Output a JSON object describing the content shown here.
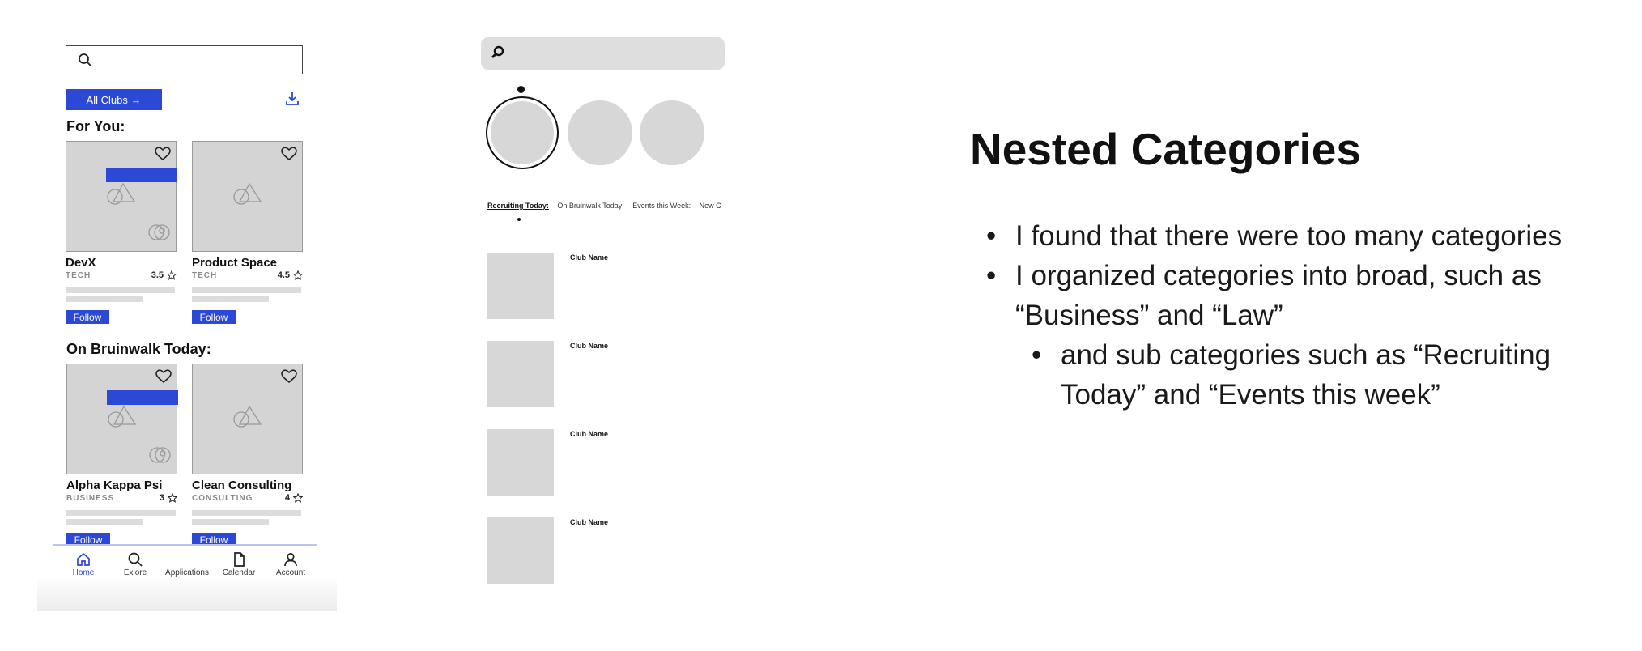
{
  "phone1": {
    "search": {
      "placeholder": ""
    },
    "all_clubs_label": "All Clubs →",
    "sections": [
      {
        "title": "For You:",
        "cards": [
          {
            "name": "DevX",
            "category": "TECH",
            "rating": "3.5",
            "follow_label": "Follow",
            "banner": true
          },
          {
            "name": "Product Space",
            "category": "TECH",
            "rating": "4.5",
            "follow_label": "Follow",
            "banner": false
          }
        ]
      },
      {
        "title": "On Bruinwalk Today:",
        "cards": [
          {
            "name": "Alpha Kappa Psi",
            "category": "BUSINESS",
            "rating": "3",
            "follow_label": "Follow",
            "banner": true
          },
          {
            "name": "Clean Consulting",
            "category": "CONSULTING",
            "rating": "4",
            "follow_label": "Follow",
            "banner": false
          }
        ]
      }
    ],
    "nav": [
      {
        "label": "Home",
        "icon": "home-icon",
        "active": true
      },
      {
        "label": "Exlore",
        "icon": "search-icon",
        "active": false
      },
      {
        "label": "Applications",
        "icon": "",
        "active": false
      },
      {
        "label": "Calendar",
        "icon": "document-icon",
        "active": false
      },
      {
        "label": "Account",
        "icon": "person-icon",
        "active": false
      }
    ],
    "accent_color": "#2b48d6"
  },
  "phone2": {
    "search": {
      "placeholder": ""
    },
    "tabs": [
      {
        "label": "Recruiting Today:",
        "active": true
      },
      {
        "label": "On Bruinwalk Today:",
        "active": false
      },
      {
        "label": "Events this Week:",
        "active": false
      },
      {
        "label": "New C",
        "active": false
      }
    ],
    "list": [
      {
        "name": "Club Name"
      },
      {
        "name": "Club Name"
      },
      {
        "name": "Club Name"
      },
      {
        "name": "Club Name"
      }
    ]
  },
  "slide": {
    "title": "Nested Categories",
    "bullets": [
      {
        "text": "I found that there were too many categories",
        "level": 1
      },
      {
        "text": "I organized categories into broad, such as “Business” and “Law”",
        "level": 1
      },
      {
        "text": "and sub categories such as “Recruiting Today” and “Events this week”",
        "level": 2
      }
    ]
  }
}
